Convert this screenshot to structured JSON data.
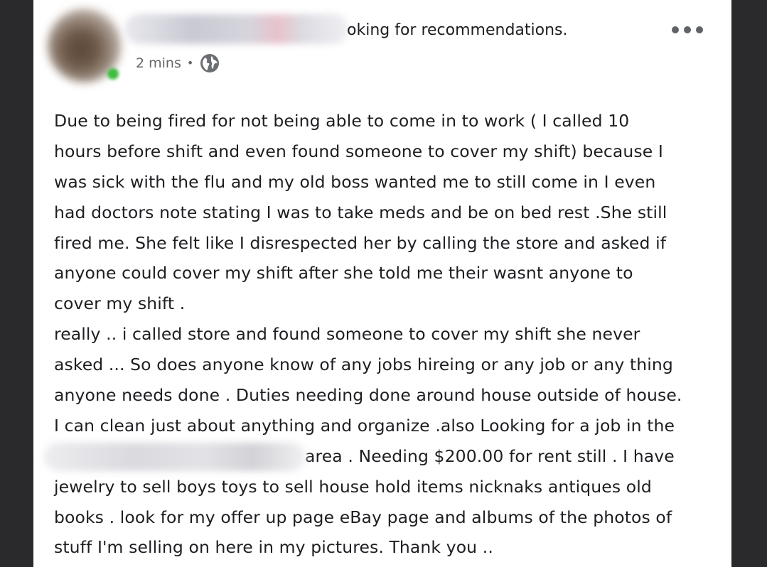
{
  "post": {
    "title_fragment": "oking for recommendations.",
    "timestamp": "2 mins",
    "separator": "•",
    "privacy_icon": "globe-icon",
    "more_icon": "more-horizontal-icon",
    "lines": [
      "Due to being fired for not being able to come in to work ( I called 10",
      "hours before shift and even found someone to cover my shift) because I",
      "was sick with the flu and my old boss wanted me to still come in I even",
      "had doctors note stating I was to take meds and be on bed rest .She still",
      "fired me. She felt like I disrespected her by calling the store and asked if",
      "anyone could cover my shift after she told me their wasnt anyone to",
      "cover my shift .",
      "really .. i called store and found someone to cover my shift she never",
      "asked ... So does anyone know of any jobs hireing or any job or any thing",
      "anyone needs done . Duties needing done around house outside of house.",
      "I can clean just about anything and organize .also Looking for a job in the"
    ],
    "line_after_blur": "area . Needing $200.00 for rent still . I have",
    "lines_end": [
      "jewelry to sell boys toys to sell house hold items nicknaks antiques old",
      "books . look for my offer up page eBay page and albums of the photos of",
      "stuff I'm selling on here in my pictures. Thank you .."
    ]
  },
  "colors": {
    "text": "#1c1e21",
    "meta": "#65676b",
    "online": "#3fbd3f",
    "background": "#ffffff",
    "frame": "#2b2b2d"
  }
}
